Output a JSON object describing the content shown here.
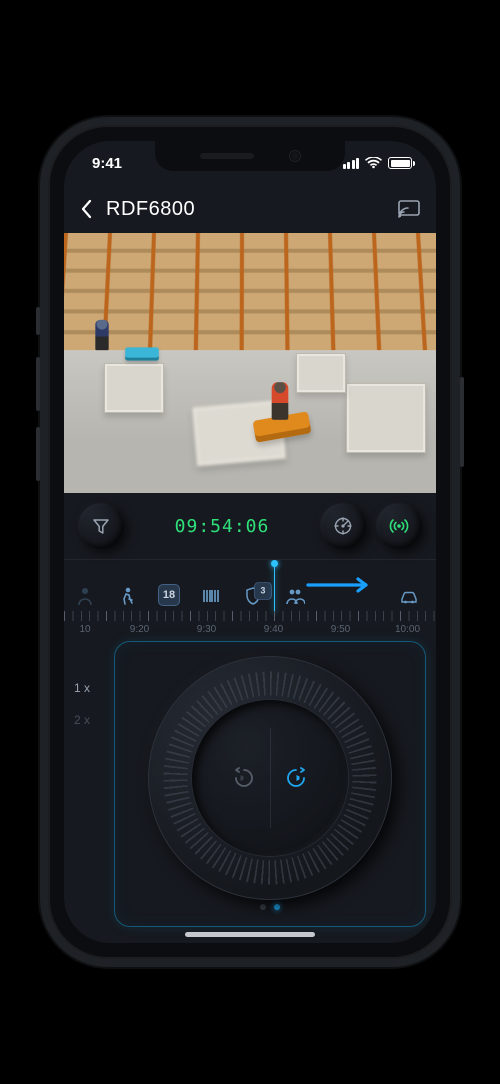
{
  "status": {
    "time": "9:41"
  },
  "header": {
    "title": "RDF6800"
  },
  "controls": {
    "timecode": "09:54:06"
  },
  "timeline": {
    "labels": [
      "10",
      "9:20",
      "9:30",
      "9:40",
      "9:50",
      "10:00"
    ],
    "events": [
      {
        "icon": "person",
        "dim": true
      },
      {
        "icon": "walk"
      },
      {
        "icon": "badge",
        "value": "18"
      },
      {
        "icon": "barcode"
      },
      {
        "icon": "shield",
        "value": "3"
      },
      {
        "icon": "group"
      },
      {
        "icon": "car"
      },
      {
        "icon": "walk",
        "dim": true
      }
    ]
  },
  "jog": {
    "speeds": [
      "1 x",
      "2 x"
    ],
    "active_speed_index": 0,
    "page_count": 2,
    "active_page_index": 1
  }
}
